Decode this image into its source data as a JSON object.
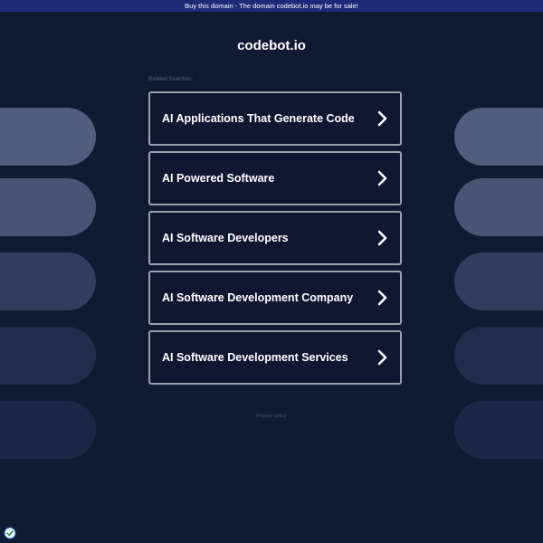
{
  "banner": {
    "text": "Buy this domain - The domain codebot.io may be for sale!"
  },
  "site": {
    "title": "codebot.io"
  },
  "related": {
    "label": "Related Searches:",
    "items": [
      {
        "label": "AI Applications That Generate Code"
      },
      {
        "label": "AI Powered Software"
      },
      {
        "label": "AI Software Developers"
      },
      {
        "label": "AI Software Development Company"
      },
      {
        "label": "AI Software Development Services"
      }
    ]
  },
  "footer": {
    "privacy": "Privacy policy"
  },
  "icons": {
    "link_arrow": "chevron-right-icon",
    "badge": "shield-check-icon"
  },
  "colors": {
    "background": "#111a33",
    "banner": "#1e2a78",
    "link_border": "#9aa0ae",
    "text": "#ffffff"
  }
}
